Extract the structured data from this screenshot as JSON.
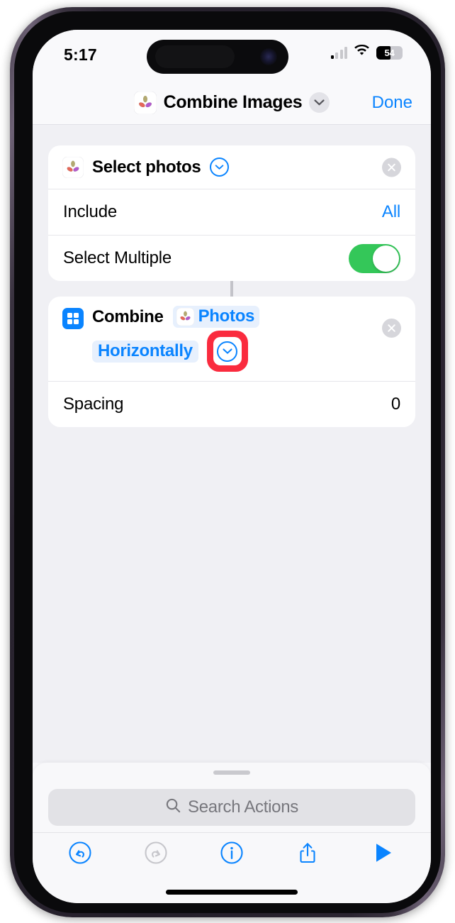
{
  "status_bar": {
    "time": "5:17",
    "cellular_icon": "cellular-signal-icon",
    "wifi_icon": "wifi-icon",
    "battery_percent": "54",
    "battery_level": 54
  },
  "nav_bar": {
    "app_icon": "photos-app-icon",
    "title": "Combine Images",
    "chevron_icon": "chevron-down-icon",
    "done_label": "Done"
  },
  "actions": [
    {
      "icon": "photos-app-icon",
      "title": "Select photos",
      "expand_icon": "chevron-down-circle-icon",
      "remove_icon": "close-circle-icon",
      "rows": [
        {
          "label": "Include",
          "value": "All",
          "type": "value"
        },
        {
          "label": "Select Multiple",
          "value": "on",
          "type": "toggle"
        }
      ]
    },
    {
      "icon": "grid-icon",
      "title": "Combine",
      "token_1": "Photos",
      "token_1_icon": "photos-app-icon",
      "token_2": "Horizontally",
      "expand_icon": "chevron-down-circle-icon",
      "remove_icon": "close-circle-icon",
      "highlighted": true,
      "rows": [
        {
          "label": "Spacing",
          "value": "0",
          "type": "plain"
        }
      ]
    }
  ],
  "sheet": {
    "grabber": "sheet-grabber",
    "search_placeholder": "Search Actions",
    "search_icon": "search-icon"
  },
  "toolbar": {
    "buttons": [
      {
        "name": "undo-icon",
        "state": "enabled"
      },
      {
        "name": "redo-icon",
        "state": "disabled"
      },
      {
        "name": "info-icon",
        "state": "enabled"
      },
      {
        "name": "share-icon",
        "state": "enabled"
      },
      {
        "name": "play-icon",
        "state": "enabled"
      }
    ]
  },
  "colors": {
    "accent_blue": "#0a84ff",
    "toggle_green": "#34c759",
    "highlight_red": "#fa2b3e",
    "content_bg": "#f0f0f4",
    "card_bg": "#ffffff"
  }
}
